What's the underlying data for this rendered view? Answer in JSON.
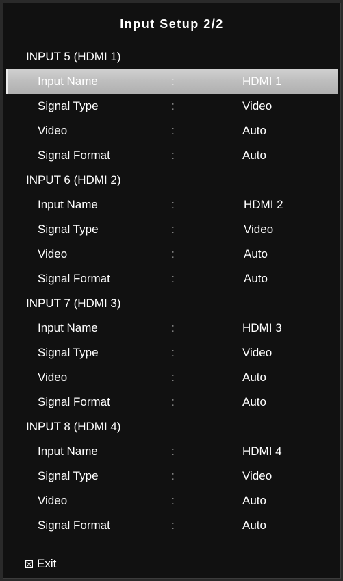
{
  "title": "Input Setup 2/2",
  "colon": ":",
  "sections": [
    {
      "header": "INPUT 5 (HDMI 1)",
      "rows": [
        {
          "label": "Input Name",
          "value": "HDMI 1",
          "selected": true
        },
        {
          "label": "Signal Type",
          "value": "Video"
        },
        {
          "label": "Video",
          "value": "Auto"
        },
        {
          "label": "Signal Format",
          "value": "Auto"
        }
      ]
    },
    {
      "header": "INPUT 6 (HDMI 2)",
      "rows": [
        {
          "label": "Input Name",
          "value": "HDMI 2"
        },
        {
          "label": "Signal Type",
          "value": "Video"
        },
        {
          "label": "Video",
          "value": "Auto"
        },
        {
          "label": "Signal Format",
          "value": "Auto"
        }
      ]
    },
    {
      "header": "INPUT 7 (HDMI 3)",
      "rows": [
        {
          "label": "Input Name",
          "value": "HDMI 3"
        },
        {
          "label": "Signal Type",
          "value": "Video"
        },
        {
          "label": "Video",
          "value": "Auto"
        },
        {
          "label": "Signal Format",
          "value": "Auto"
        }
      ]
    },
    {
      "header": "INPUT 8 (HDMI 4)",
      "rows": [
        {
          "label": "Input Name",
          "value": "HDMI 4"
        },
        {
          "label": "Signal Type",
          "value": "Video"
        },
        {
          "label": "Video",
          "value": "Auto"
        },
        {
          "label": "Signal Format",
          "value": "Auto"
        }
      ]
    }
  ],
  "footer": {
    "exit_icon": "exit-icon",
    "exit_label": "Exit"
  }
}
